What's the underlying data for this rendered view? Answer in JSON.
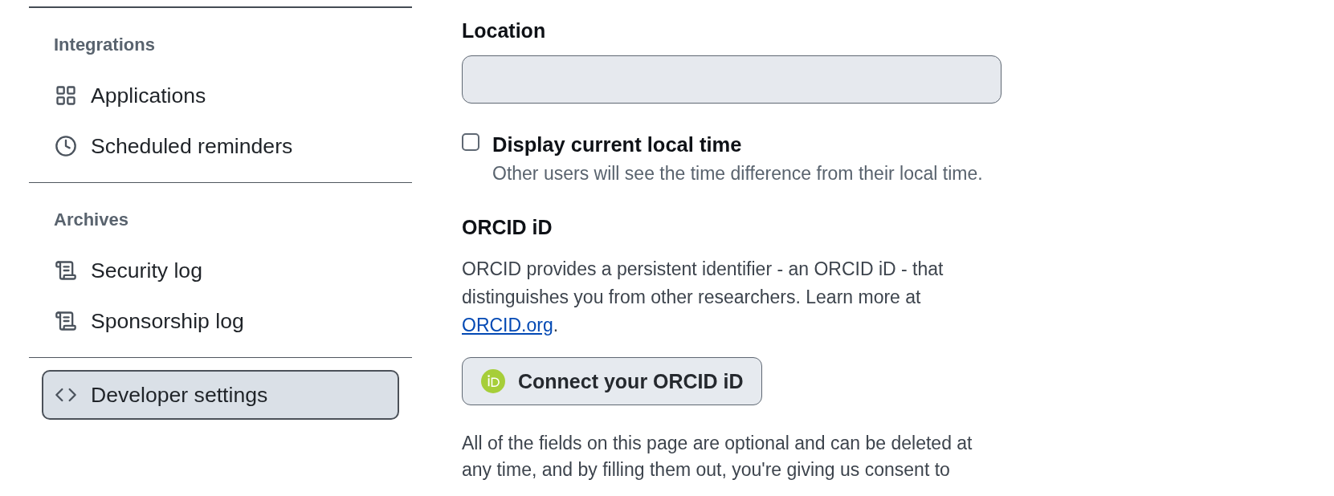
{
  "sidebar": {
    "groups": [
      {
        "heading": "Integrations",
        "items": [
          {
            "label": "Applications",
            "selected": false
          },
          {
            "label": "Scheduled reminders",
            "selected": false
          }
        ]
      },
      {
        "heading": "Archives",
        "items": [
          {
            "label": "Security log",
            "selected": false
          },
          {
            "label": "Sponsorship log",
            "selected": false
          }
        ]
      },
      {
        "items": [
          {
            "label": "Developer settings",
            "selected": true
          }
        ]
      }
    ]
  },
  "location": {
    "label": "Location"
  },
  "local_time": {
    "label": "Display current local time",
    "checked": false,
    "hint": "Other users will see the time difference from their local time."
  },
  "orcid": {
    "heading": "ORCID iD",
    "description": "ORCID provides a persistent identifier - an ORCID iD - that distinguishes you from other researchers. Learn more at",
    "link": "ORCID.org",
    "link_suffix": ".",
    "button": "Connect your ORCID iD"
  },
  "notice": "All of the fields on this page are optional and can be deleted at any time, and by filling them out, you're giving us consent to"
}
